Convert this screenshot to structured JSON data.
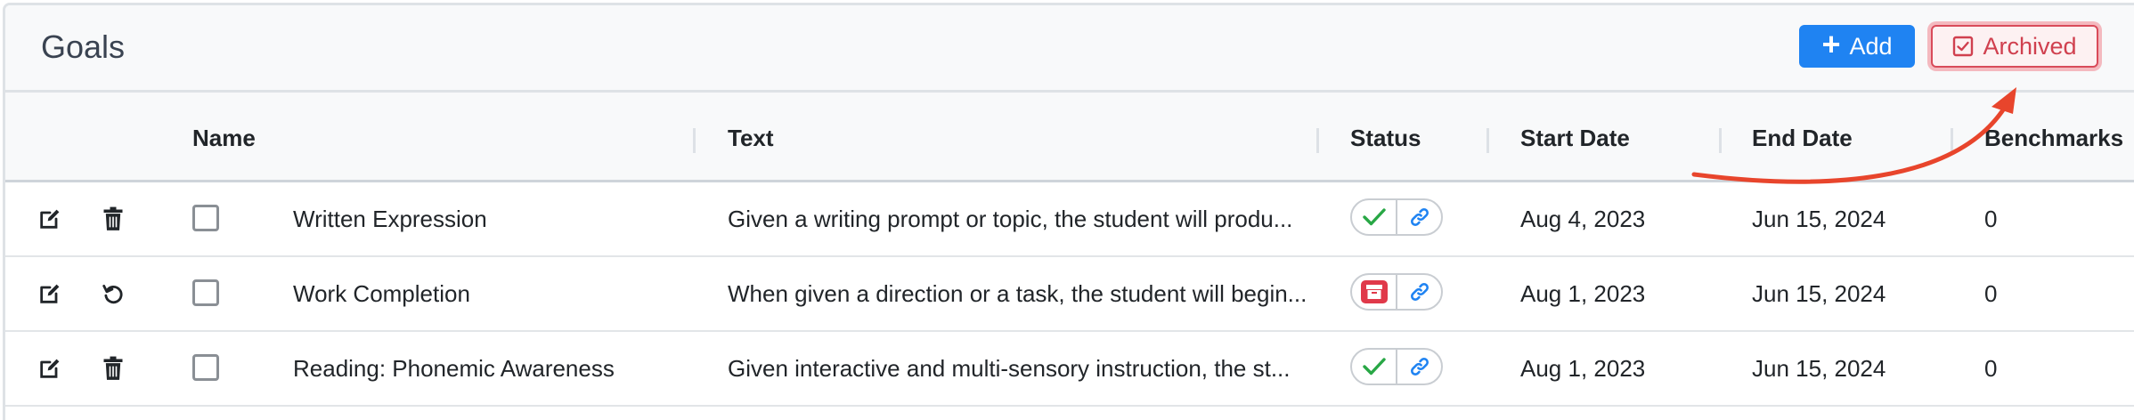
{
  "header": {
    "title": "Goals",
    "add_label": "Add",
    "archived_label": "Archived"
  },
  "columns": {
    "name": "Name",
    "text": "Text",
    "status": "Status",
    "start_date": "Start Date",
    "end_date": "End Date",
    "benchmarks": "Benchmarks"
  },
  "rows": [
    {
      "name": "Written Expression",
      "text": "Given a writing prompt or topic, the student will produ...",
      "status": "complete",
      "start_date": "Aug 4, 2023",
      "end_date": "Jun 15, 2024",
      "benchmarks": "0",
      "secondary_action": "trash-icon"
    },
    {
      "name": "Work Completion",
      "text": "When given a direction or a task, the student will begin...",
      "status": "archived",
      "start_date": "Aug 1, 2023",
      "end_date": "Jun 15, 2024",
      "benchmarks": "0",
      "secondary_action": "restore-icon"
    },
    {
      "name": "Reading: Phonemic Awareness",
      "text": "Given interactive and multi-sensory instruction, the st...",
      "status": "complete",
      "start_date": "Aug 1, 2023",
      "end_date": "Jun 15, 2024",
      "benchmarks": "0",
      "secondary_action": "trash-icon"
    }
  ],
  "colors": {
    "primary": "#1f83f2",
    "danger": "#d0404f",
    "success": "#28a745",
    "link": "#1f83f2",
    "annotation_arrow": "#e8452c"
  }
}
